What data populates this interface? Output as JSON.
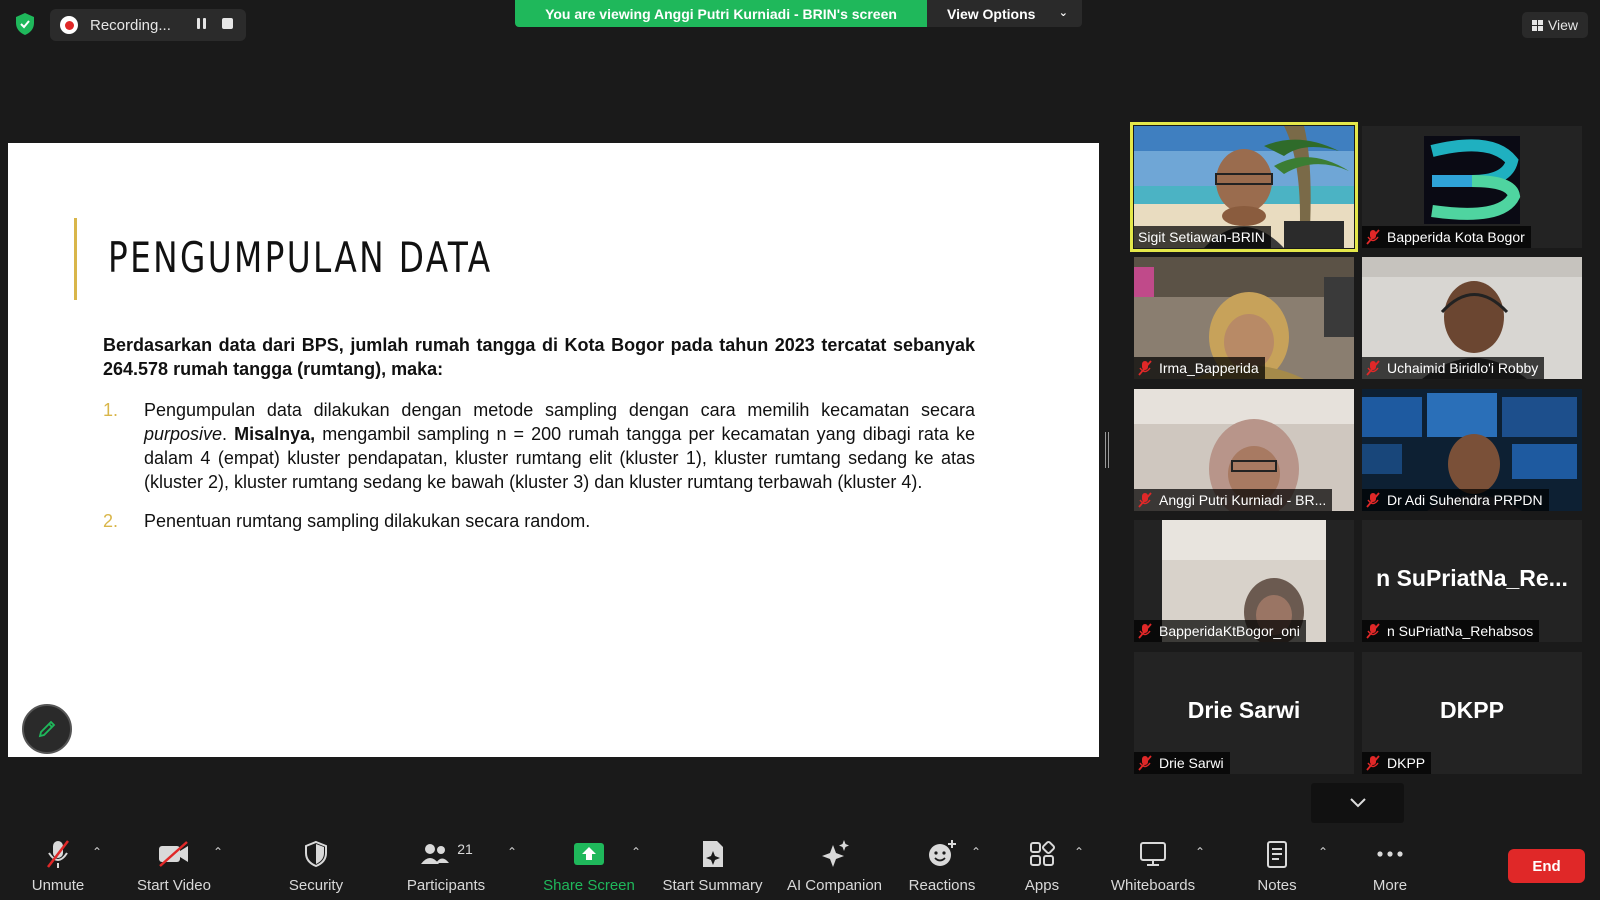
{
  "top_bar": {
    "recording_label": "Recording...",
    "viewing_banner": "You are viewing Anggi Putri Kurniadi - BRIN's screen",
    "view_options_label": "View Options",
    "view_label": "View"
  },
  "slide": {
    "title": "PENGUMPULAN DATA",
    "intro": "Berdasarkan data dari BPS, jumlah rumah tangga di Kota Bogor pada  tahun 2023 tercatat sebanyak 264.578 rumah tangga (rumtang), maka:",
    "items": [
      {
        "number": "1.",
        "part_a": "Pengumpulan data dilakukan dengan metode sampling dengan cara memilih kecamatan secara ",
        "emphasis": "purposive",
        "part_b": ". ",
        "bold": "Misalnya,",
        "part_c": " mengambil sampling n = 200 rumah tangga per kecamatan yang dibagi rata ke dalam 4 (empat) kluster pendapatan, kluster rumtang elit (kluster 1), kluster rumtang sedang ke atas (kluster 2), kluster rumtang sedang ke bawah (kluster 3) dan kluster rumtang terbawah (kluster 4)."
      },
      {
        "number": "2.",
        "text": "Penentuan rumtang sampling dilakukan secara random."
      }
    ]
  },
  "participants": [
    {
      "name": "Sigit Setiawan-BRIN",
      "muted": false,
      "active": true
    },
    {
      "name": "Bapperida Kota Bogor",
      "muted": true,
      "active": false
    },
    {
      "name": "Irma_Bapperida",
      "muted": true,
      "active": false
    },
    {
      "name": "Uchaimid Biridlo'i Robby",
      "muted": true,
      "active": false
    },
    {
      "name": "Anggi Putri Kurniadi - BR...",
      "muted": true,
      "active": false
    },
    {
      "name": "Dr Adi Suhendra PRPDN",
      "muted": true,
      "active": false
    },
    {
      "name": "BapperidaKtBogor_oni",
      "muted": true,
      "active": false
    },
    {
      "name": "n SuPriatNa_Rehabsos",
      "big_name": "n  SuPriatNa_Re...",
      "muted": true,
      "active": false
    },
    {
      "name": "Drie Sarwi",
      "big_name": "Drie Sarwi",
      "muted": true,
      "active": false
    },
    {
      "name": "DKPP",
      "big_name": "DKPP",
      "muted": true,
      "active": false
    }
  ],
  "toolbar": {
    "unmute": "Unmute",
    "start_video": "Start Video",
    "security": "Security",
    "participants": "Participants",
    "participants_count": "21",
    "share_screen": "Share Screen",
    "start_summary": "Start Summary",
    "ai_companion": "AI Companion",
    "reactions": "Reactions",
    "apps": "Apps",
    "whiteboards": "Whiteboards",
    "notes": "Notes",
    "more": "More",
    "end": "End"
  },
  "colors": {
    "background": "#1a1a1a",
    "banner_green": "#1fb85b",
    "end_red": "#e02828",
    "active_speaker": "#e5e84a",
    "slide_accent": "#d9b64a"
  }
}
